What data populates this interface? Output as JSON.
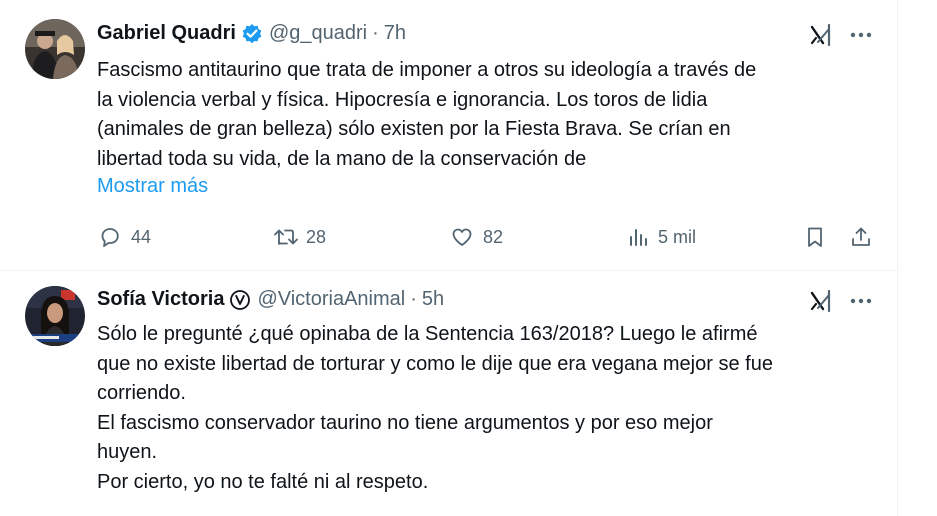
{
  "tweets": [
    {
      "name": "Gabriel Quadri",
      "verified": "blue-check",
      "handle": "@g_quadri",
      "separator": "·",
      "time": "7h",
      "lines": [
        "Fascismo antitaurino que trata de imponer a otros su ideología a través de",
        "la violencia verbal y física. Hipocresía e ignorancia. Los toros de lidia",
        "(animales de gran belleza) sólo existen por la Fiesta Brava. Se crían en",
        "libertad toda su vida,  de la mano de la conservación de"
      ],
      "show_more": "Mostrar más",
      "stats": {
        "replies": "44",
        "retweets": "28",
        "likes": "82",
        "views": "5 mil"
      }
    },
    {
      "name": "Sofía Victoria",
      "verified": "grey-v-badge",
      "handle": "@VictoriaAnimal",
      "separator": "·",
      "time": "5h",
      "lines": [
        "Sólo le pregunté ¿qué opinaba de la Sentencia 163/2018? Luego le afirmé",
        "que no existe libertad de torturar y como le dije que era vegana mejor se fue",
        "corriendo.",
        "El fascismo conservador taurino no tiene argumentos y por eso mejor",
        "huyen.",
        "Por cierto, yo no te falté ni al respeto."
      ]
    }
  ],
  "colors": {
    "text": "#0f1419",
    "secondary": "#536471",
    "link": "#1d9bf0",
    "divider": "#eff3f4"
  }
}
